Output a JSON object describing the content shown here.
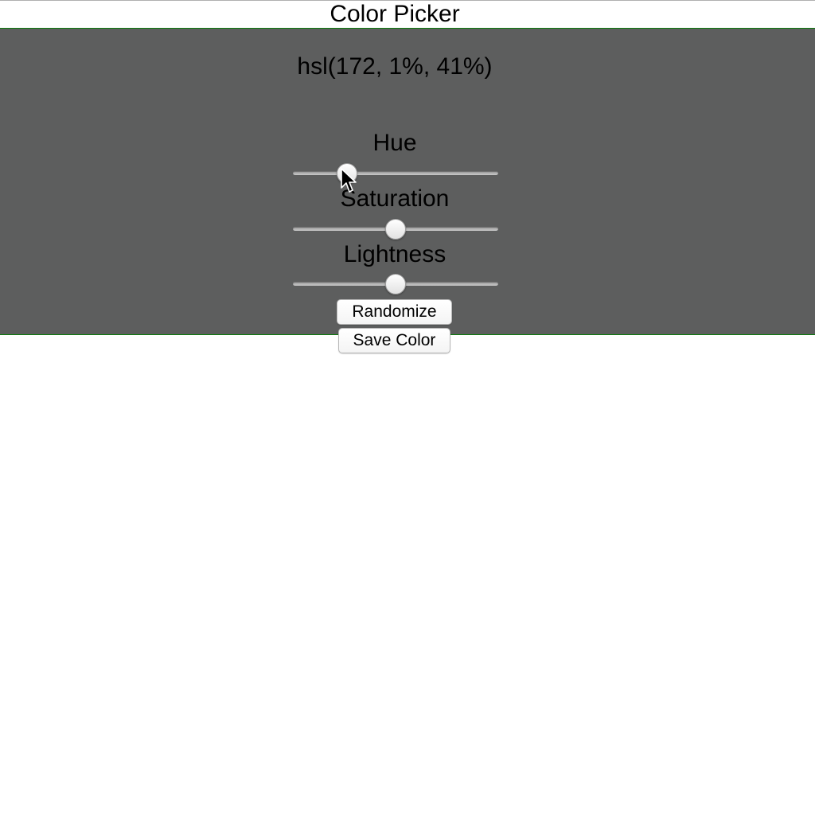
{
  "app": {
    "title": "Color Picker"
  },
  "picker": {
    "hsl_text": "hsl(172, 1%, 41%)",
    "swatch_color": "#5d5e5e",
    "sliders": [
      {
        "label": "Hue",
        "value": 172,
        "min": 0,
        "max": 720
      },
      {
        "label": "Saturation",
        "value": 50,
        "min": 0,
        "max": 100
      },
      {
        "label": "Lightness",
        "value": 50,
        "min": 0,
        "max": 100
      }
    ]
  },
  "actions": {
    "randomize_label": "Randomize",
    "save_label": "Save Color"
  },
  "colors": {
    "panel_border": "#0a7a0a",
    "page_background": "#ffffff"
  },
  "cursor": {
    "icon": "arrow-pointer-icon"
  }
}
